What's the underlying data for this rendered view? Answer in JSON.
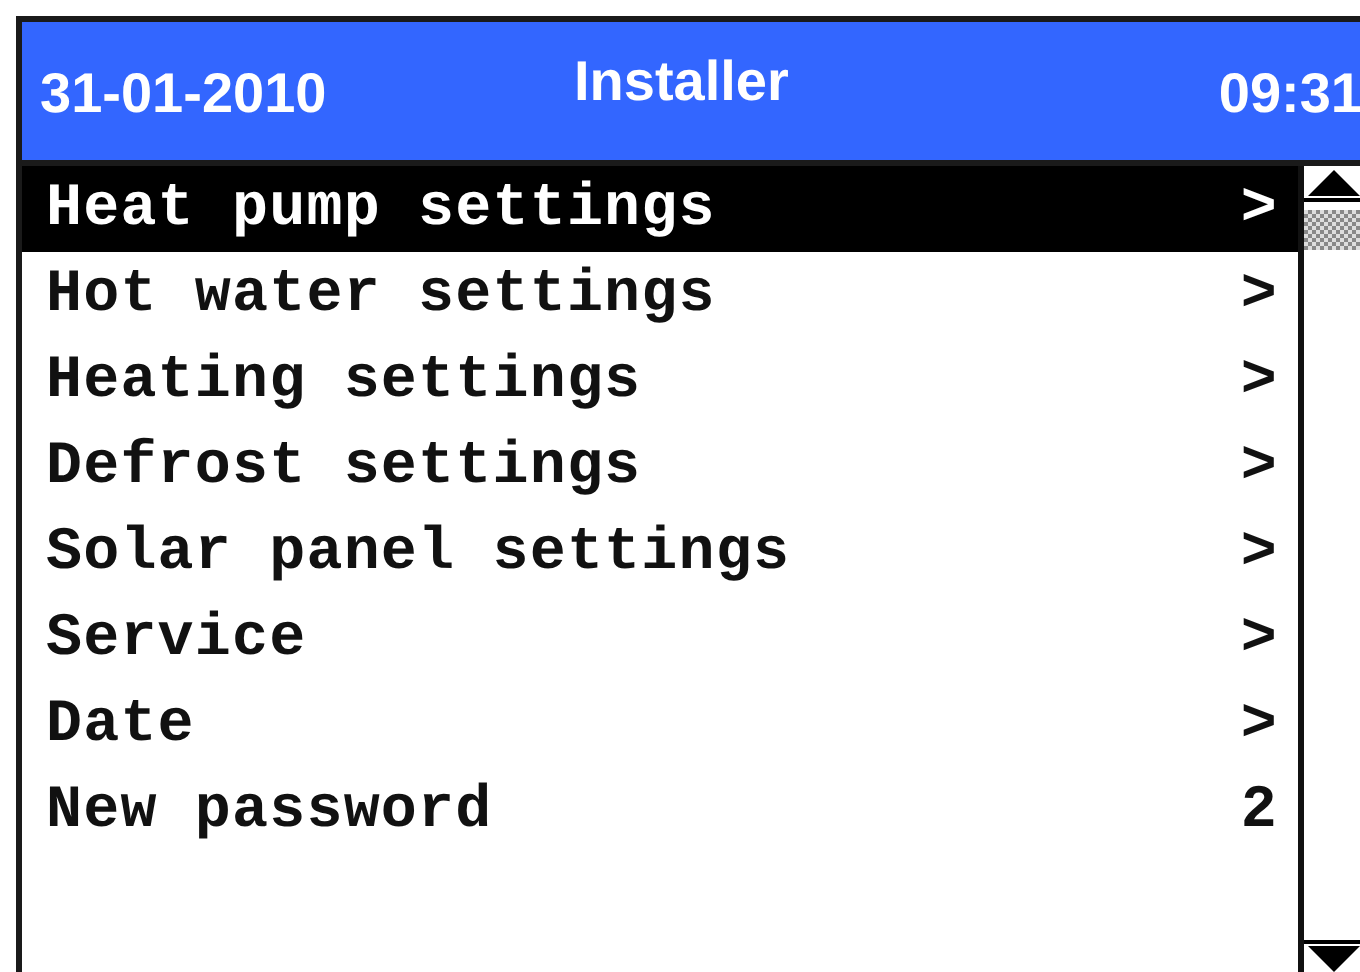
{
  "header": {
    "date": "31-01-2010",
    "title": "Installer",
    "time": "09:31"
  },
  "menu": [
    {
      "label": "Heat pump settings",
      "value": ">",
      "selected": true
    },
    {
      "label": "Hot water settings",
      "value": ">",
      "selected": false
    },
    {
      "label": "Heating settings",
      "value": ">",
      "selected": false
    },
    {
      "label": "Defrost settings",
      "value": ">",
      "selected": false
    },
    {
      "label": "Solar panel settings",
      "value": ">",
      "selected": false
    },
    {
      "label": "Service",
      "value": ">",
      "selected": false
    },
    {
      "label": "Date",
      "value": ">",
      "selected": false
    },
    {
      "label": "New password",
      "value": "2",
      "selected": false
    }
  ]
}
